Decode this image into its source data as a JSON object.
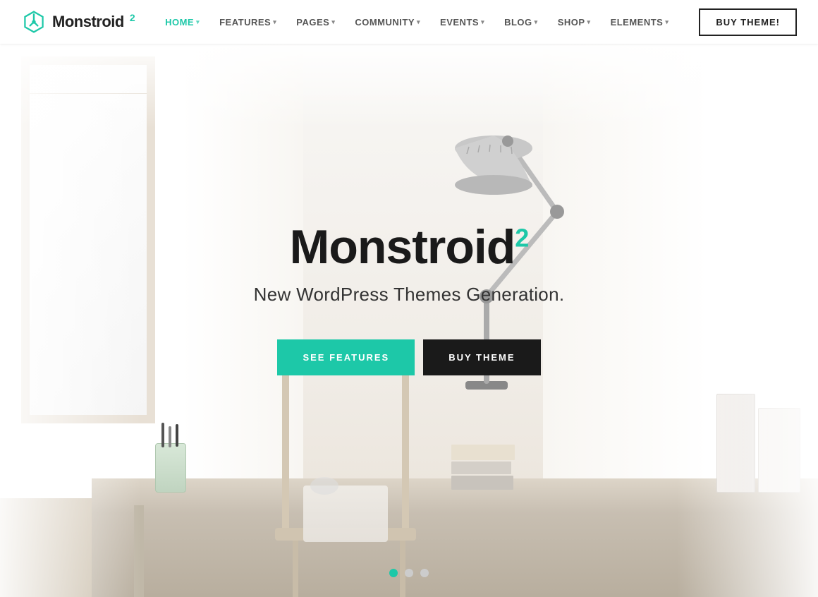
{
  "logo": {
    "text": "Monstroid",
    "superscript": "2"
  },
  "nav": {
    "items": [
      {
        "label": "HOME",
        "active": true
      },
      {
        "label": "FEATURES",
        "active": false
      },
      {
        "label": "PAGES",
        "active": false
      },
      {
        "label": "COMMUNITY",
        "active": false
      },
      {
        "label": "EVENTS",
        "active": false
      },
      {
        "label": "BLOG",
        "active": false
      },
      {
        "label": "SHOP",
        "active": false
      },
      {
        "label": "ELEMENTS",
        "active": false
      }
    ],
    "buy_button": "BUY THEME!"
  },
  "hero": {
    "title": "Monstroid",
    "title_sup": "2",
    "subtitle": "New WordPress Themes Generation.",
    "btn_features": "SEE FEATURES",
    "btn_buy": "BUY THEME"
  },
  "slider": {
    "dots": [
      {
        "active": true
      },
      {
        "active": false
      },
      {
        "active": false
      }
    ]
  },
  "colors": {
    "accent": "#1dc8a8",
    "dark": "#1a1a1a",
    "text": "#333333"
  }
}
